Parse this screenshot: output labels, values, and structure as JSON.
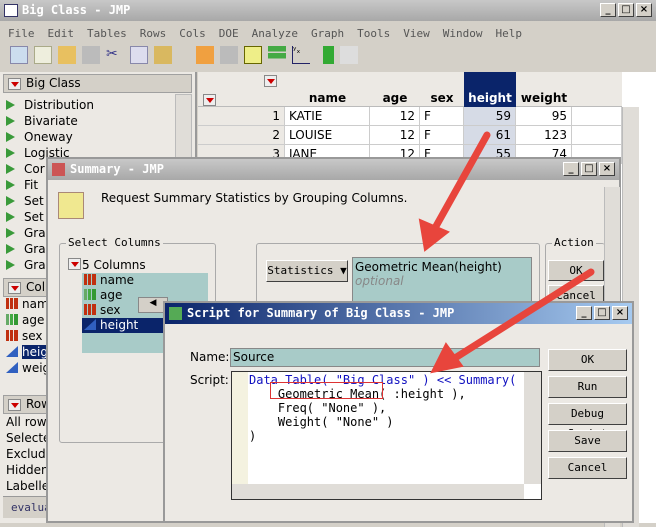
{
  "main_window": {
    "title": "Big Class - JMP",
    "menu": [
      "File",
      "Edit",
      "Tables",
      "Rows",
      "Cols",
      "DOE",
      "Analyze",
      "Graph",
      "Tools",
      "View",
      "Window",
      "Help"
    ],
    "panel": {
      "title": "Big Class",
      "items": [
        "Distribution",
        "Bivariate",
        "Oneway",
        "Logistic",
        "Cor",
        "Fit",
        "Set",
        "Set",
        "Gra",
        "Gra",
        "Gra"
      ]
    },
    "columns_panel": {
      "title": "Colu",
      "items": [
        {
          "name": "name",
          "type": "nominal"
        },
        {
          "name": "age",
          "type": "ordinal"
        },
        {
          "name": "sex",
          "type": "nominal"
        },
        {
          "name": "height",
          "type": "continuous",
          "selected": true
        },
        {
          "name": "weight",
          "type": "continuous"
        }
      ]
    },
    "rows_panel": {
      "title": "Rows",
      "items": [
        "All rows",
        "Selected",
        "Excluded",
        "Hidden",
        "Labelled"
      ]
    },
    "status": "evaluations done",
    "table": {
      "headers": [
        "name",
        "age",
        "sex",
        "height",
        "weight"
      ],
      "rows": [
        [
          "1",
          "KATIE",
          "12",
          "F",
          "59",
          "95"
        ],
        [
          "2",
          "LOUISE",
          "12",
          "F",
          "61",
          "123"
        ],
        [
          "3",
          "JANE",
          "12",
          "F",
          "55",
          "74"
        ]
      ]
    }
  },
  "summary_dialog": {
    "title": "Summary - JMP",
    "instruction": "Request Summary Statistics by Grouping Columns.",
    "select_columns_label": "Select Columns",
    "columns_count": "5 Columns",
    "columns": [
      "name",
      "age",
      "sex",
      "height"
    ],
    "statistics_button": "Statistics",
    "statistic_value": "Geometric Mean(height)",
    "optional_placeholder": "optional",
    "action_label": "Action",
    "ok": "OK",
    "cancel": "Cancel"
  },
  "script_dialog": {
    "title": "Script for Summary of Big Class - JMP",
    "name_label": "Name:",
    "name_value": "Source",
    "script_label": "Script:",
    "script_lines": [
      "Data Table( \"Big Class\" ) << Summary(",
      "    Geometric Mean( :height ),",
      "    Freq( \"None\" ),",
      "    Weight( \"None\" )",
      ")"
    ],
    "buttons": [
      "OK",
      "Run",
      "Debug Script",
      "Save",
      "Cancel"
    ]
  },
  "annotation_color": "#e8453c"
}
